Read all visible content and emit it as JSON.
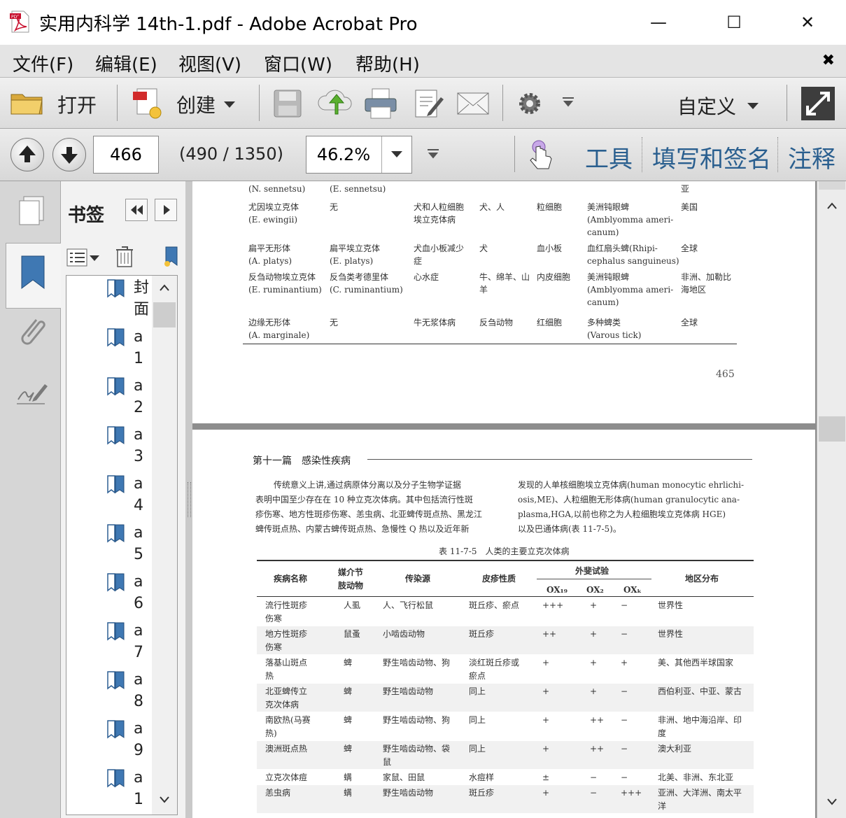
{
  "window": {
    "title": "实用内科学 14th-1.pdf - Adobe Acrobat Pro",
    "minimize": "—",
    "maximize": "☐",
    "close": "✕"
  },
  "menu": [
    "文件(F)",
    "编辑(E)",
    "视图(V)",
    "窗口(W)",
    "帮助(H)"
  ],
  "menu_close": "✖",
  "toolbar": {
    "open_label": "打开",
    "create_label": "创建",
    "customize_label": "自定义"
  },
  "nav": {
    "current_page": "466",
    "page_info": "(490 / 1350)",
    "zoom": "46.2%",
    "tools_label": "工具",
    "sign_label": "填写和签名",
    "comment_label": "注释"
  },
  "bookmarks": {
    "header": "书签",
    "items": [
      {
        "label": "封面"
      },
      {
        "label": "a1"
      },
      {
        "label": "a2"
      },
      {
        "label": "a3"
      },
      {
        "label": "a4"
      },
      {
        "label": "a5"
      },
      {
        "label": "a6"
      },
      {
        "label": "a7"
      },
      {
        "label": "a8"
      },
      {
        "label": "a9"
      },
      {
        "label": "a1"
      }
    ]
  },
  "page_top": {
    "rows": [
      {
        "c1": "(N. sennetsu)",
        "c2": "(E. sennetsu)",
        "c3": "",
        "c4": "",
        "c5": "",
        "c6": "",
        "c7": "亚"
      },
      {
        "c1": "尤因埃立克体\n(E. ewingii)",
        "c2": "无",
        "c3": "犬和人粒细胞\n埃立克体病",
        "c4": "犬、人",
        "c5": "粒细胞",
        "c6": "美洲钝眼蜱\n(Amblyomma ameri-\ncanum)",
        "c7": "美国"
      },
      {
        "c1": "扁平无形体\n(A. platys)",
        "c2": "扁平埃立克体\n(E. platys)",
        "c3": "犬血小板减少\n症",
        "c4": "犬",
        "c5": "血小板",
        "c6": "血红扇头蜱(Rhipi-\ncephalus sanguineus)",
        "c7": "全球"
      },
      {
        "c1": "反刍动物埃立克体\n(E. ruminantium)",
        "c2": "反刍类考德里体\n(C. ruminantium)",
        "c3": "心水症",
        "c4": "牛、绵羊、山\n羊",
        "c5": "内皮细胞",
        "c6": "美洲钝眼蜱\n(Amblyomma ameri-\ncanum)",
        "c7": "非洲、加勒比\n海地区"
      },
      {
        "c1": "边缘无形体\n(A. marginale)",
        "c2": "无",
        "c3": "牛无浆体病",
        "c4": "反刍动物",
        "c5": "红细胞",
        "c6": "多种蜱类\n(Varous tick)",
        "c7": "全球"
      }
    ],
    "page_number": "465"
  },
  "page_bottom": {
    "section": "第十一篇　感染性疾病",
    "para_left": [
      "传统意义上讲,通过病原体分离以及分子生物学证据",
      "表明中国至少存在在 10 种立克次体病。其中包括流行性斑",
      "疹伤寒、地方性斑疹伤寒、恙虫病、北亚蜱传斑点热、黑龙江",
      "蜱传斑点热、内蒙古蜱传斑点热、急慢性 Q 热以及近年新"
    ],
    "para_right": [
      "发现的人单核细胞埃立克体病(human monocytic ehrlichi-",
      "osis,ME)、人粒细胞无形体病(human granulocytic ana-",
      "plasma,HGA,以前也称之为人粒细胞埃立克体病 HGE)",
      "以及巴通体病(表 11-7-5)。"
    ],
    "table_title": "表 11-7-5　人类的主要立克次体病",
    "headers": {
      "disease": "疾病名称",
      "vector": "媒介节\n肢动物",
      "source": "传染源",
      "rash": "皮疹性质",
      "weilfelix": "外斐试验",
      "ox19": "OX₁₉",
      "ox2": "OX₂",
      "oxk": "OXₖ",
      "region": "地区分布"
    },
    "rows": [
      {
        "disease": "流行性斑疹\n伤寒",
        "vector": "人虱",
        "source": "人、飞行松鼠",
        "rash": "斑丘疹、瘀点",
        "ox19": "+++",
        "ox2": "+",
        "oxk": "−",
        "region": "世界性"
      },
      {
        "disease": "地方性斑疹\n伤寒",
        "vector": "鼠蚤",
        "source": "小啮齿动物",
        "rash": "斑丘疹",
        "ox19": "++",
        "ox2": "+",
        "oxk": "−",
        "region": "世界性"
      },
      {
        "disease": "落基山斑点\n热",
        "vector": "蜱",
        "source": "野生啮齿动物、狗",
        "rash": "淡红斑丘疹或\n瘀点",
        "ox19": "+",
        "ox2": "+",
        "oxk": "+",
        "region": "美、其他西半球国家"
      },
      {
        "disease": "北亚蜱传立\n克次体病",
        "vector": "蜱",
        "source": "野生啮齿动物",
        "rash": "同上",
        "ox19": "+",
        "ox2": "+",
        "oxk": "−",
        "region": "西伯利亚、中亚、蒙古"
      },
      {
        "disease": "南欧热(马赛\n热)",
        "vector": "蜱",
        "source": "野生啮齿动物、狗",
        "rash": "同上",
        "ox19": "+",
        "ox2": "++",
        "oxk": "−",
        "region": "非洲、地中海沿岸、印\n度"
      },
      {
        "disease": "澳洲斑点热",
        "vector": "蜱",
        "source": "野生啮齿动物、袋\n鼠",
        "rash": "同上",
        "ox19": "+",
        "ox2": "++",
        "oxk": "−",
        "region": "澳大利亚"
      },
      {
        "disease": "立克次体痘",
        "vector": "螨",
        "source": "家鼠、田鼠",
        "rash": "水痘样",
        "ox19": "±",
        "ox2": "−",
        "oxk": "−",
        "region": "北美、非洲、东北亚"
      },
      {
        "disease": "恙虫病",
        "vector": "螨",
        "source": "野生啮齿动物",
        "rash": "斑丘疹",
        "ox19": "+",
        "ox2": "−",
        "oxk": "+++",
        "region": "亚洲、大洋洲、南太平\n洋"
      }
    ]
  }
}
